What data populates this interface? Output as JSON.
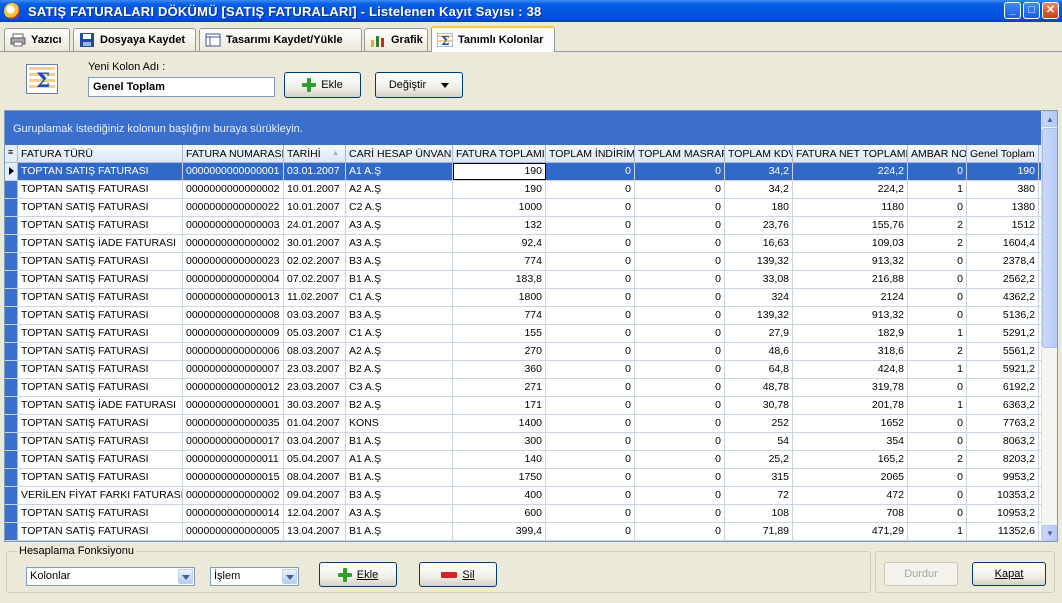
{
  "window": {
    "title": "SATIŞ FATURALARI DÖKÜMÜ [SATIŞ FATURALARI]  -  Listelenen Kayıt Sayısı : 38",
    "controls": [
      "minimize",
      "maximize",
      "close"
    ]
  },
  "tabs": [
    {
      "label": "Yazıcı",
      "icon": "printer-icon"
    },
    {
      "label": "Dosyaya Kaydet",
      "icon": "floppy-disk-icon"
    },
    {
      "label": "Tasarımı Kaydet/Yükle",
      "icon": "layout-icon"
    },
    {
      "label": "Grafik",
      "icon": "bar-chart-icon"
    },
    {
      "label": "Tanımlı Kolonlar",
      "icon": "sigma-icon",
      "active": true
    }
  ],
  "toppanel": {
    "new_column_label": "Yeni Kolon Adı :",
    "new_column_value": "Genel Toplam",
    "add_button": "Ekle",
    "change_button": "Değiştir"
  },
  "grid": {
    "group_hint": "Guruplamak istediğiniz kolonun başlığını buraya sürükleyin.",
    "columns": [
      "FATURA TÜRÜ",
      "FATURA NUMARASI",
      "TARİHİ",
      "CARİ HESAP ÜNVANI",
      "FATURA TOPLAMI",
      "TOPLAM İNDİRİM",
      "TOPLAM MASRAF",
      "TOPLAM KDV",
      "FATURA NET TOPLAMI",
      "AMBAR NO",
      "Genel Toplam"
    ],
    "sort_indicator": "▲",
    "rows": [
      [
        "TOPTAN SATIŞ FATURASI",
        "0000000000000001",
        "03.01.2007",
        "A1 A.Ş",
        "190",
        "0",
        "0",
        "34,2",
        "224,2",
        "0",
        "190"
      ],
      [
        "TOPTAN SATIŞ FATURASI",
        "0000000000000002",
        "10.01.2007",
        "A2 A.Ş",
        "190",
        "0",
        "0",
        "34,2",
        "224,2",
        "1",
        "380"
      ],
      [
        "TOPTAN SATIŞ FATURASI",
        "0000000000000022",
        "10.01.2007",
        "C2 A.Ş",
        "1000",
        "0",
        "0",
        "180",
        "1180",
        "0",
        "1380"
      ],
      [
        "TOPTAN SATIŞ FATURASI",
        "0000000000000003",
        "24.01.2007",
        "A3 A.Ş",
        "132",
        "0",
        "0",
        "23,76",
        "155,76",
        "2",
        "1512"
      ],
      [
        "TOPTAN SATIŞ İADE FATURASI",
        "0000000000000002",
        "30.01.2007",
        "A3 A.Ş",
        "92,4",
        "0",
        "0",
        "16,63",
        "109,03",
        "2",
        "1604,4"
      ],
      [
        "TOPTAN SATIŞ FATURASI",
        "0000000000000023",
        "02.02.2007",
        "B3 A.Ş",
        "774",
        "0",
        "0",
        "139,32",
        "913,32",
        "0",
        "2378,4"
      ],
      [
        "TOPTAN SATIŞ FATURASI",
        "0000000000000004",
        "07.02.2007",
        "B1 A.Ş",
        "183,8",
        "0",
        "0",
        "33,08",
        "216,88",
        "0",
        "2562,2"
      ],
      [
        "TOPTAN SATIŞ FATURASI",
        "0000000000000013",
        "11.02.2007",
        "C1 A.Ş",
        "1800",
        "0",
        "0",
        "324",
        "2124",
        "0",
        "4362,2"
      ],
      [
        "TOPTAN SATIŞ FATURASI",
        "0000000000000008",
        "03.03.2007",
        "B3 A.Ş",
        "774",
        "0",
        "0",
        "139,32",
        "913,32",
        "0",
        "5136,2"
      ],
      [
        "TOPTAN SATIŞ FATURASI",
        "0000000000000009",
        "05.03.2007",
        "C1 A.Ş",
        "155",
        "0",
        "0",
        "27,9",
        "182,9",
        "1",
        "5291,2"
      ],
      [
        "TOPTAN SATIŞ FATURASI",
        "0000000000000006",
        "08.03.2007",
        "A2 A.Ş",
        "270",
        "0",
        "0",
        "48,6",
        "318,6",
        "2",
        "5561,2"
      ],
      [
        "TOPTAN SATIŞ FATURASI",
        "0000000000000007",
        "23.03.2007",
        "B2 A.Ş",
        "360",
        "0",
        "0",
        "64,8",
        "424,8",
        "1",
        "5921,2"
      ],
      [
        "TOPTAN SATIŞ FATURASI",
        "0000000000000012",
        "23.03.2007",
        "C3 A.Ş",
        "271",
        "0",
        "0",
        "48,78",
        "319,78",
        "0",
        "6192,2"
      ],
      [
        "TOPTAN SATIŞ İADE FATURASI",
        "0000000000000001",
        "30.03.2007",
        "B2 A.Ş",
        "171",
        "0",
        "0",
        "30,78",
        "201,78",
        "1",
        "6363,2"
      ],
      [
        "TOPTAN SATIŞ FATURASI",
        "0000000000000035",
        "01.04.2007",
        "KONS",
        "1400",
        "0",
        "0",
        "252",
        "1652",
        "0",
        "7763,2"
      ],
      [
        "TOPTAN SATIŞ FATURASI",
        "0000000000000017",
        "03.04.2007",
        "B1 A.Ş",
        "300",
        "0",
        "0",
        "54",
        "354",
        "0",
        "8063,2"
      ],
      [
        "TOPTAN SATIŞ FATURASI",
        "0000000000000011",
        "05.04.2007",
        "A1 A.Ş",
        "140",
        "0",
        "0",
        "25,2",
        "165,2",
        "2",
        "8203,2"
      ],
      [
        "TOPTAN SATIŞ FATURASI",
        "0000000000000015",
        "08.04.2007",
        "B1 A.Ş",
        "1750",
        "0",
        "0",
        "315",
        "2065",
        "0",
        "9953,2"
      ],
      [
        "VERİLEN FİYAT FARKI FATURASI",
        "0000000000000002",
        "09.04.2007",
        "B3 A.Ş",
        "400",
        "0",
        "0",
        "72",
        "472",
        "0",
        "10353,2"
      ],
      [
        "TOPTAN SATIŞ FATURASI",
        "0000000000000014",
        "12.04.2007",
        "A3 A.Ş",
        "600",
        "0",
        "0",
        "108",
        "708",
        "0",
        "10953,2"
      ],
      [
        "TOPTAN SATIŞ FATURASI",
        "0000000000000005",
        "13.04.2007",
        "B1 A.Ş",
        "399,4",
        "0",
        "0",
        "71,89",
        "471,29",
        "1",
        "11352,6"
      ]
    ],
    "selected_row": 0
  },
  "bottom": {
    "group_label": "Hesaplama Fonksiyonu",
    "columns_select": "Kolonlar",
    "operation_select": "İşlem",
    "add_button": "Ekle",
    "delete_button": "Sil",
    "stop_button": "Durdur",
    "close_button": "Kapat"
  },
  "colors": {
    "title_bar": "#0054e3",
    "group_bar": "#3a6fcb",
    "selected_row": "#3169c6"
  }
}
